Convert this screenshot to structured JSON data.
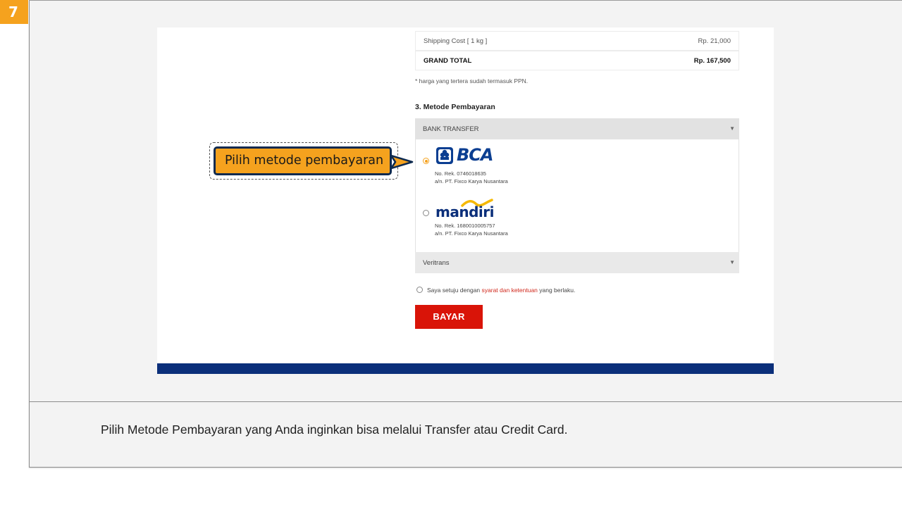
{
  "step": {
    "number": "7"
  },
  "order_summary": {
    "shipping_label": "Shipping Cost [ 1 kg ]",
    "shipping_value": "Rp. 21,000",
    "total_label": "GRAND TOTAL",
    "total_value": "Rp. 167,500",
    "tax_note": "* harga yang tertera sudah termasuk PPN."
  },
  "payment": {
    "section_title": "3. Metode Pembayaran",
    "bank_transfer": {
      "label": "BANK TRANSFER",
      "options": [
        {
          "bank": "BCA",
          "account_line": "No. Rek. 0746018635",
          "holder_line": "a/n. PT. Fixco Karya Nusantara",
          "selected": true
        },
        {
          "bank": "mandiri",
          "account_line": "No. Rek. 1680010005757",
          "holder_line": "a/n. PT. Fixco Karya Nusantara",
          "selected": false
        }
      ]
    },
    "veritrans": {
      "label": "Veritrans"
    },
    "caret": "▼"
  },
  "agreement": {
    "prefix": "Saya setuju dengan ",
    "link": "syarat dan ketentuan",
    "suffix": " yang berlaku."
  },
  "pay_button": {
    "label": "BAYAR"
  },
  "callout": {
    "text": "Pilih metode pembayaran"
  },
  "caption": {
    "text": "Pilih Metode Pembayaran yang Anda inginkan bisa melalui Transfer atau Credit Card."
  },
  "colors": {
    "accent": "#f5a21e",
    "navy": "#0b2f7a",
    "button_red": "#d91408",
    "link_red": "#d0281c"
  }
}
